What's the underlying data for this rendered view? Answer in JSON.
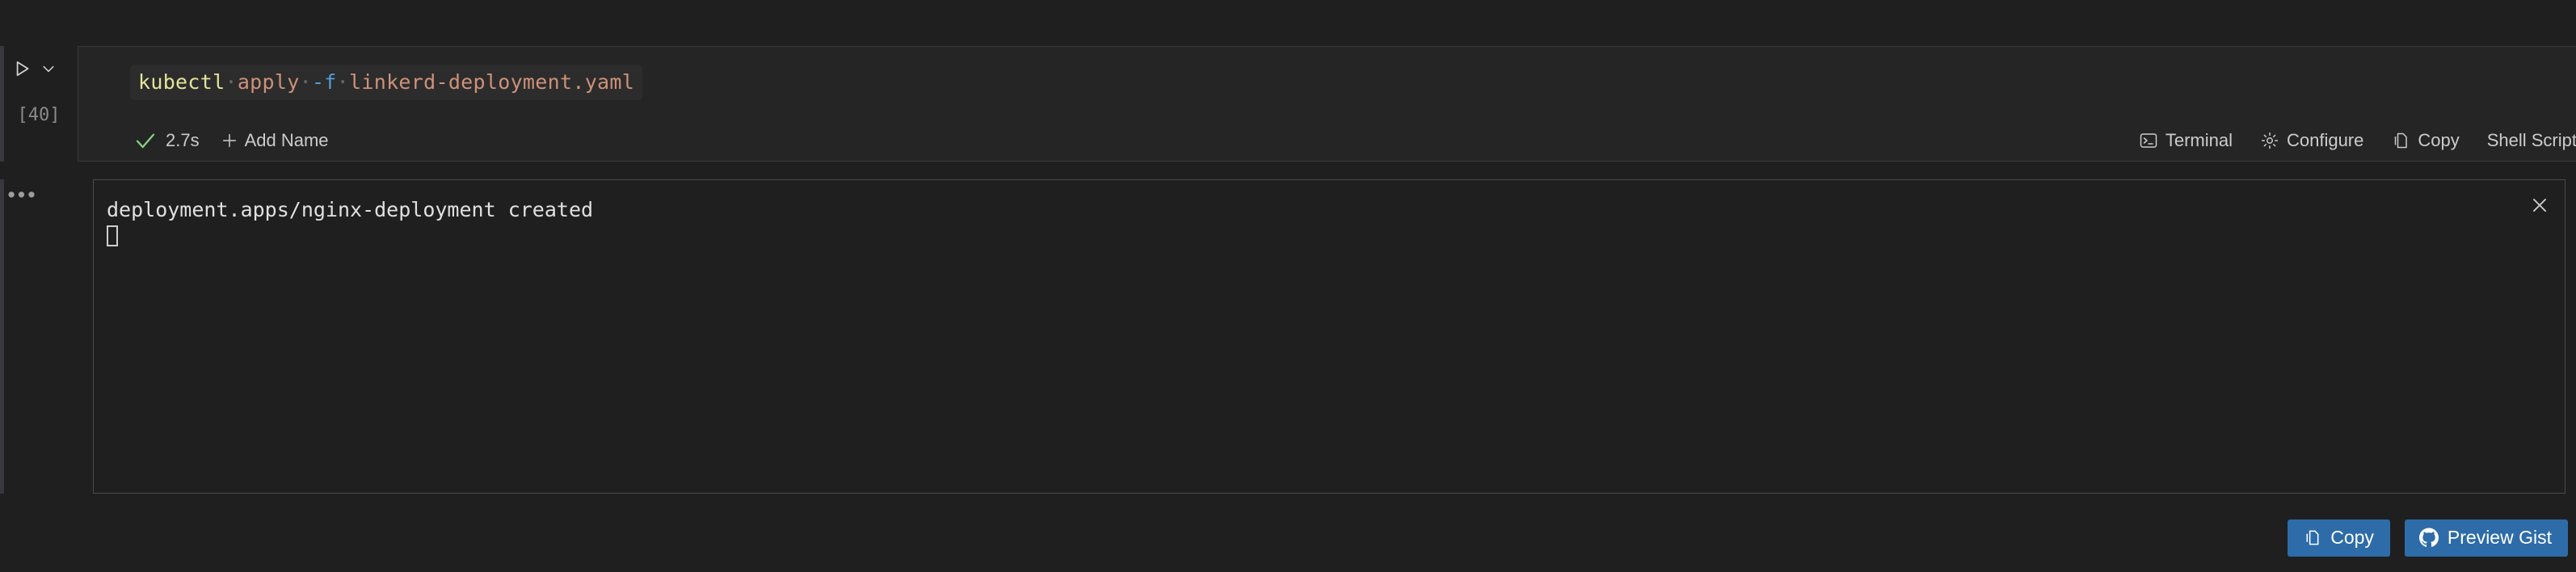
{
  "cell": {
    "execution_count": "[40]",
    "run_icon": "play-triangle-icon",
    "chevron_icon": "chevron-down-icon",
    "more_icon": "•••",
    "command": {
      "tokens": [
        {
          "text": "kubectl",
          "kind": "cmd"
        },
        {
          "text": "·",
          "kind": "ws"
        },
        {
          "text": "apply",
          "kind": "arg"
        },
        {
          "text": "·",
          "kind": "ws"
        },
        {
          "text": "-f",
          "kind": "flag"
        },
        {
          "text": "·",
          "kind": "ws"
        },
        {
          "text": "linkerd-deployment.yaml",
          "kind": "arg"
        }
      ],
      "plain": "kubectl apply -f linkerd-deployment.yaml"
    }
  },
  "status": {
    "success_icon": "check-icon",
    "success_color": "#89d185",
    "duration": "2.7s",
    "add_name_label": "Add Name",
    "add_name_icon": "plus-icon"
  },
  "toolbar": {
    "items": [
      {
        "label": "Terminal",
        "icon": "terminal-icon"
      },
      {
        "label": "Configure",
        "icon": "gear-icon"
      },
      {
        "label": "Copy",
        "icon": "copy-icon"
      },
      {
        "label": "Shell Script",
        "icon": "none"
      }
    ]
  },
  "output": {
    "text": "deployment.apps/nginx-deployment created",
    "cursor": true,
    "close_icon": "close-icon"
  },
  "actions": {
    "buttons": [
      {
        "label": "Copy",
        "icon": "copy-icon"
      },
      {
        "label": "Preview Gist",
        "icon": "github-icon"
      }
    ]
  },
  "colors": {
    "background": "#1f1f1f",
    "cell_background": "#252526",
    "border": "#3b3b3d",
    "accent_button": "#2d6ca8",
    "token_command": "#e4e49a",
    "token_argument": "#ce9178",
    "token_flag": "#569cd6",
    "success": "#89d185"
  }
}
